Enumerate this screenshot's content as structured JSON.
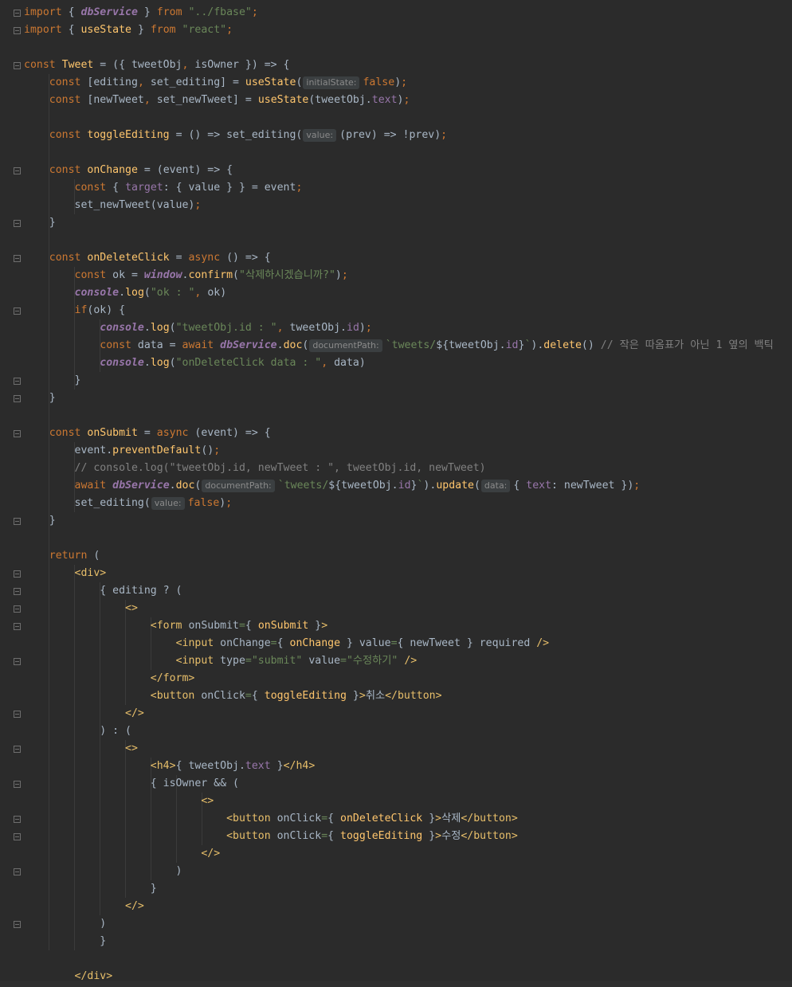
{
  "theme": {
    "background": "#2b2b2b",
    "keyword": "#cc7832",
    "function": "#ffc66d",
    "string": "#6a8759",
    "property": "#9876aa",
    "comment": "#808080",
    "tag": "#e8bf6a",
    "text": "#a9b7c6"
  },
  "lines": [
    [
      [
        "kw",
        "import "
      ],
      [
        "pl",
        "{ "
      ],
      [
        "gv",
        "dbService"
      ],
      [
        "pl",
        " } "
      ],
      [
        "kw",
        "from "
      ],
      [
        "str",
        "\"../fbase\""
      ],
      [
        "kw",
        ";"
      ]
    ],
    [
      [
        "kw",
        "import "
      ],
      [
        "pl",
        "{ "
      ],
      [
        "fn",
        "useState"
      ],
      [
        "pl",
        " } "
      ],
      [
        "kw",
        "from "
      ],
      [
        "str",
        "\"react\""
      ],
      [
        "kw",
        ";"
      ]
    ],
    [],
    [
      [
        "kw",
        "const "
      ],
      [
        "fn",
        "Tweet"
      ],
      [
        "pl",
        " = ({ tweetObj"
      ],
      [
        "kw",
        ", "
      ],
      [
        "pl",
        "isOwner }) => {"
      ]
    ],
    [
      [
        "pl",
        "    "
      ],
      [
        "kw",
        "const "
      ],
      [
        "pl",
        "[editing"
      ],
      [
        "kw",
        ", "
      ],
      [
        "pl",
        "set_editing] = "
      ],
      [
        "fn",
        "useState"
      ],
      [
        "pl",
        "("
      ],
      [
        "hint",
        "initialState:"
      ],
      [
        "kw",
        "false"
      ],
      [
        "pl",
        ")"
      ],
      [
        "kw",
        ";"
      ]
    ],
    [
      [
        "pl",
        "    "
      ],
      [
        "kw",
        "const "
      ],
      [
        "pl",
        "[newTweet"
      ],
      [
        "kw",
        ", "
      ],
      [
        "pl",
        "set_newTweet] = "
      ],
      [
        "fn",
        "useState"
      ],
      [
        "pl",
        "(tweetObj."
      ],
      [
        "prop",
        "text"
      ],
      [
        "pl",
        ")"
      ],
      [
        "kw",
        ";"
      ]
    ],
    [],
    [
      [
        "pl",
        "    "
      ],
      [
        "kw",
        "const "
      ],
      [
        "fn",
        "toggleEditing"
      ],
      [
        "pl",
        " = () => set_editing("
      ],
      [
        "hint",
        "value:"
      ],
      [
        "pl",
        "(prev) => !prev)"
      ],
      [
        "kw",
        ";"
      ]
    ],
    [],
    [
      [
        "pl",
        "    "
      ],
      [
        "kw",
        "const "
      ],
      [
        "fn",
        "onChange"
      ],
      [
        "pl",
        " = (event) => {"
      ]
    ],
    [
      [
        "pl",
        "        "
      ],
      [
        "kw",
        "const "
      ],
      [
        "pl",
        "{ "
      ],
      [
        "prop",
        "target"
      ],
      [
        "pl",
        ": { value } } = event"
      ],
      [
        "kw",
        ";"
      ]
    ],
    [
      [
        "pl",
        "        set_newTweet(value)"
      ],
      [
        "kw",
        ";"
      ]
    ],
    [
      [
        "pl",
        "    }"
      ]
    ],
    [],
    [
      [
        "pl",
        "    "
      ],
      [
        "kw",
        "const "
      ],
      [
        "fn",
        "onDeleteClick"
      ],
      [
        "pl",
        " = "
      ],
      [
        "kw",
        "async "
      ],
      [
        "pl",
        "() => {"
      ]
    ],
    [
      [
        "pl",
        "        "
      ],
      [
        "kw",
        "const "
      ],
      [
        "pl",
        "ok = "
      ],
      [
        "gv",
        "window"
      ],
      [
        "pl",
        "."
      ],
      [
        "fn",
        "confirm"
      ],
      [
        "pl",
        "("
      ],
      [
        "str",
        "\"삭제하시겠습니까?\""
      ],
      [
        "pl",
        ")"
      ],
      [
        "kw",
        ";"
      ]
    ],
    [
      [
        "pl",
        "        "
      ],
      [
        "gv",
        "console"
      ],
      [
        "pl",
        "."
      ],
      [
        "fn",
        "log"
      ],
      [
        "pl",
        "("
      ],
      [
        "str",
        "\"ok : \""
      ],
      [
        "kw",
        ", "
      ],
      [
        "pl",
        "ok)"
      ]
    ],
    [
      [
        "pl",
        "        "
      ],
      [
        "kw",
        "if"
      ],
      [
        "pl",
        "(ok) {"
      ]
    ],
    [
      [
        "pl",
        "            "
      ],
      [
        "gv",
        "console"
      ],
      [
        "pl",
        "."
      ],
      [
        "fn",
        "log"
      ],
      [
        "pl",
        "("
      ],
      [
        "str",
        "\"tweetObj.id : \""
      ],
      [
        "kw",
        ", "
      ],
      [
        "pl",
        "tweetObj."
      ],
      [
        "prop",
        "id"
      ],
      [
        "pl",
        ")"
      ],
      [
        "kw",
        ";"
      ]
    ],
    [
      [
        "pl",
        "            "
      ],
      [
        "kw",
        "const "
      ],
      [
        "pl",
        "data = "
      ],
      [
        "kw",
        "await "
      ],
      [
        "gv",
        "dbService"
      ],
      [
        "pl",
        "."
      ],
      [
        "fn",
        "doc"
      ],
      [
        "pl",
        "("
      ],
      [
        "hint",
        "documentPath:"
      ],
      [
        "str",
        "`tweets/"
      ],
      [
        "pl",
        "${tweetObj."
      ],
      [
        "prop",
        "id"
      ],
      [
        "pl",
        "}"
      ],
      [
        "str",
        "`"
      ],
      [
        "pl",
        ")."
      ],
      [
        "fn",
        "delete"
      ],
      [
        "pl",
        "() "
      ],
      [
        "cmt",
        "// 작은 따옴표가 아닌 1 옆의 백틱"
      ]
    ],
    [
      [
        "pl",
        "            "
      ],
      [
        "gv",
        "console"
      ],
      [
        "pl",
        "."
      ],
      [
        "fn",
        "log"
      ],
      [
        "pl",
        "("
      ],
      [
        "str",
        "\"onDeleteClick data : \""
      ],
      [
        "kw",
        ", "
      ],
      [
        "pl",
        "data)"
      ]
    ],
    [
      [
        "pl",
        "        }"
      ]
    ],
    [
      [
        "pl",
        "    }"
      ]
    ],
    [],
    [
      [
        "pl",
        "    "
      ],
      [
        "kw",
        "const "
      ],
      [
        "fn",
        "onSubmit"
      ],
      [
        "pl",
        " = "
      ],
      [
        "kw",
        "async "
      ],
      [
        "pl",
        "(event) => {"
      ]
    ],
    [
      [
        "pl",
        "        event."
      ],
      [
        "fn",
        "preventDefault"
      ],
      [
        "pl",
        "()"
      ],
      [
        "kw",
        ";"
      ]
    ],
    [
      [
        "pl",
        "        "
      ],
      [
        "cmt",
        "// console.log(\"tweetObj.id, newTweet : \", tweetObj.id, newTweet)"
      ]
    ],
    [
      [
        "pl",
        "        "
      ],
      [
        "kw",
        "await "
      ],
      [
        "gv",
        "dbService"
      ],
      [
        "pl",
        "."
      ],
      [
        "fn",
        "doc"
      ],
      [
        "pl",
        "("
      ],
      [
        "hint",
        "documentPath:"
      ],
      [
        "str",
        "`tweets/"
      ],
      [
        "pl",
        "${tweetObj."
      ],
      [
        "prop",
        "id"
      ],
      [
        "pl",
        "}"
      ],
      [
        "str",
        "`"
      ],
      [
        "pl",
        ")."
      ],
      [
        "fn",
        "update"
      ],
      [
        "pl",
        "("
      ],
      [
        "hint",
        "data:"
      ],
      [
        "pl",
        "{ "
      ],
      [
        "prop",
        "text"
      ],
      [
        "pl",
        ": newTweet })"
      ],
      [
        "kw",
        ";"
      ]
    ],
    [
      [
        "pl",
        "        set_editing("
      ],
      [
        "hint",
        "value:"
      ],
      [
        "kw",
        "false"
      ],
      [
        "pl",
        ")"
      ],
      [
        "kw",
        ";"
      ]
    ],
    [
      [
        "pl",
        "    }"
      ]
    ],
    [],
    [
      [
        "pl",
        "    "
      ],
      [
        "kw",
        "return "
      ],
      [
        "pl",
        "("
      ]
    ],
    [
      [
        "pl",
        "        "
      ],
      [
        "tag",
        "<div>"
      ]
    ],
    [
      [
        "pl",
        "            { editing ? ("
      ]
    ],
    [
      [
        "pl",
        "                "
      ],
      [
        "tag",
        "<>"
      ]
    ],
    [
      [
        "pl",
        "                    "
      ],
      [
        "tag",
        "<form "
      ],
      [
        "pl",
        "onSubmit"
      ],
      [
        "str",
        "="
      ],
      [
        "pl",
        "{ "
      ],
      [
        "fn",
        "onSubmit"
      ],
      [
        "pl",
        " }"
      ],
      [
        "tag",
        ">"
      ]
    ],
    [
      [
        "pl",
        "                        "
      ],
      [
        "tag",
        "<input "
      ],
      [
        "pl",
        "onChange"
      ],
      [
        "str",
        "="
      ],
      [
        "pl",
        "{ "
      ],
      [
        "fn",
        "onChange"
      ],
      [
        "pl",
        " } value"
      ],
      [
        "str",
        "="
      ],
      [
        "pl",
        "{ newTweet } required "
      ],
      [
        "tag",
        "/>"
      ]
    ],
    [
      [
        "pl",
        "                        "
      ],
      [
        "tag",
        "<input "
      ],
      [
        "pl",
        "type"
      ],
      [
        "str",
        "=\"submit\" "
      ],
      [
        "pl",
        "value"
      ],
      [
        "str",
        "=\"수정하기\" "
      ],
      [
        "tag",
        "/>"
      ]
    ],
    [
      [
        "pl",
        "                    "
      ],
      [
        "tag",
        "</form>"
      ]
    ],
    [
      [
        "pl",
        "                    "
      ],
      [
        "tag",
        "<button "
      ],
      [
        "pl",
        "onClick"
      ],
      [
        "str",
        "="
      ],
      [
        "pl",
        "{ "
      ],
      [
        "fn",
        "toggleEditing"
      ],
      [
        "pl",
        " }"
      ],
      [
        "tag",
        ">"
      ],
      [
        "pl",
        "취소"
      ],
      [
        "tag",
        "</button>"
      ]
    ],
    [
      [
        "pl",
        "                "
      ],
      [
        "tag",
        "</>"
      ]
    ],
    [
      [
        "pl",
        "            ) : ("
      ]
    ],
    [
      [
        "pl",
        "                "
      ],
      [
        "tag",
        "<>"
      ]
    ],
    [
      [
        "pl",
        "                    "
      ],
      [
        "tag",
        "<h4>"
      ],
      [
        "pl",
        "{ tweetObj."
      ],
      [
        "prop",
        "text"
      ],
      [
        "pl",
        " }"
      ],
      [
        "tag",
        "</h4>"
      ]
    ],
    [
      [
        "pl",
        "                    { isOwner && ("
      ]
    ],
    [
      [
        "pl",
        "                            "
      ],
      [
        "tag",
        "<>"
      ]
    ],
    [
      [
        "pl",
        "                                "
      ],
      [
        "tag",
        "<button "
      ],
      [
        "pl",
        "onClick"
      ],
      [
        "str",
        "="
      ],
      [
        "pl",
        "{ "
      ],
      [
        "fn",
        "onDeleteClick"
      ],
      [
        "pl",
        " }"
      ],
      [
        "tag",
        ">"
      ],
      [
        "pl",
        "삭제"
      ],
      [
        "tag",
        "</button>"
      ]
    ],
    [
      [
        "pl",
        "                                "
      ],
      [
        "tag",
        "<button "
      ],
      [
        "pl",
        "onClick"
      ],
      [
        "str",
        "="
      ],
      [
        "pl",
        "{ "
      ],
      [
        "fn",
        "toggleEditing"
      ],
      [
        "pl",
        " }"
      ],
      [
        "tag",
        ">"
      ],
      [
        "pl",
        "수정"
      ],
      [
        "tag",
        "</button>"
      ]
    ],
    [
      [
        "pl",
        "                            "
      ],
      [
        "tag",
        "</>"
      ]
    ],
    [
      [
        "pl",
        "                        )"
      ]
    ],
    [
      [
        "pl",
        "                    }"
      ]
    ],
    [
      [
        "pl",
        "                "
      ],
      [
        "tag",
        "</>"
      ]
    ],
    [
      [
        "pl",
        "            )"
      ]
    ],
    [
      [
        "pl",
        "            }"
      ]
    ],
    [],
    [
      [
        "pl",
        "        "
      ],
      [
        "tag",
        "</div>"
      ]
    ]
  ]
}
